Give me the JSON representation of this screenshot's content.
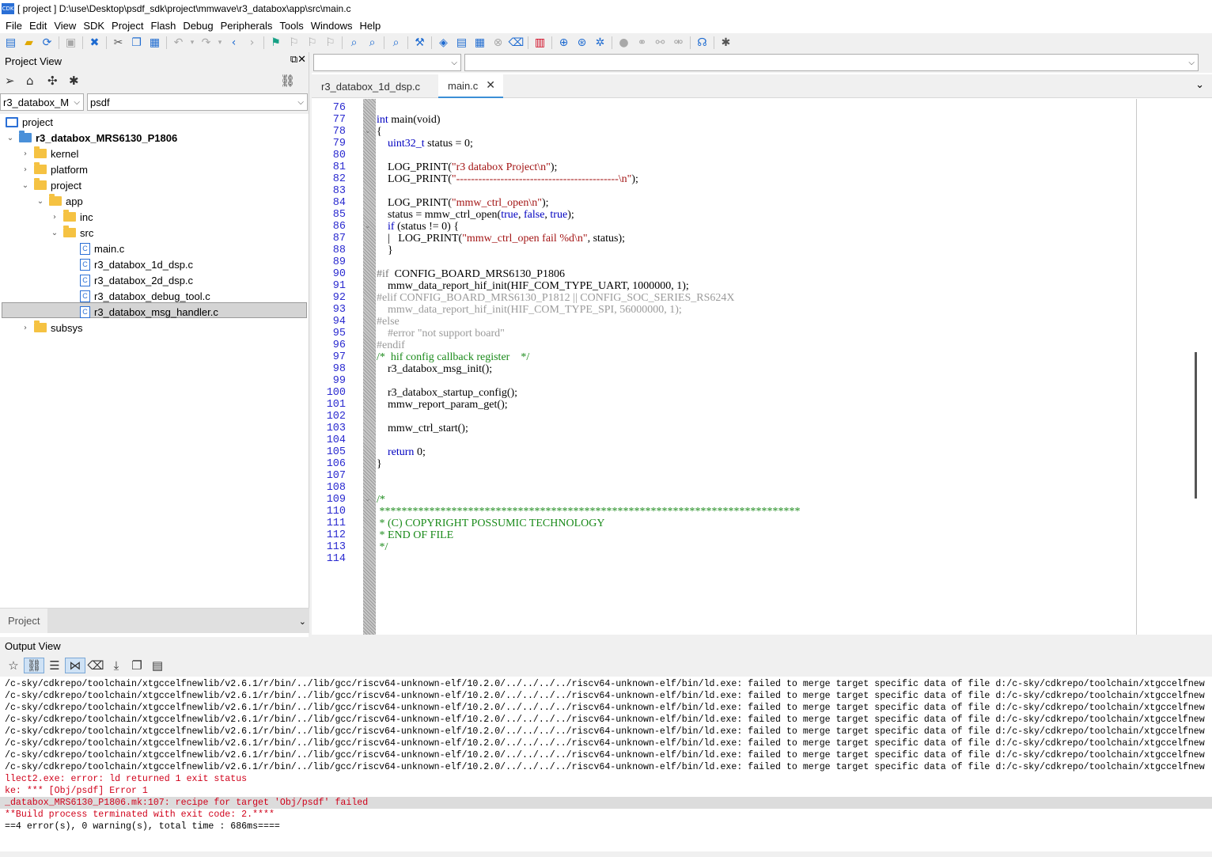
{
  "window": {
    "title": "[ project ] D:\\use\\Desktop\\psdf_sdk\\project\\mmwave\\r3_databox\\app\\src\\main.c",
    "icon_text": "CDK"
  },
  "menu": [
    "File",
    "Edit",
    "View",
    "SDK",
    "Project",
    "Flash",
    "Debug",
    "Peripherals",
    "Tools",
    "Windows",
    "Help"
  ],
  "project_view": {
    "title": "Project View",
    "combo_project": "r3_databox_M",
    "combo_config": "psdf",
    "tree": [
      {
        "label": "project",
        "depth": 0,
        "type": "root"
      },
      {
        "label": "r3_databox_MRS6130_P1806",
        "depth": 0,
        "type": "blue-folder",
        "bold": true,
        "expanded": true
      },
      {
        "label": "kernel",
        "depth": 1,
        "type": "folder",
        "expanded": false
      },
      {
        "label": "platform",
        "depth": 1,
        "type": "folder",
        "expanded": false
      },
      {
        "label": "project",
        "depth": 1,
        "type": "folder",
        "expanded": true
      },
      {
        "label": "app",
        "depth": 2,
        "type": "folder",
        "expanded": true
      },
      {
        "label": "inc",
        "depth": 3,
        "type": "folder",
        "expanded": false
      },
      {
        "label": "src",
        "depth": 3,
        "type": "folder",
        "expanded": true
      },
      {
        "label": "main.c",
        "depth": 4,
        "type": "cfile",
        "selected": true
      },
      {
        "label": "r3_databox_1d_dsp.c",
        "depth": 4,
        "type": "cfile"
      },
      {
        "label": "r3_databox_2d_dsp.c",
        "depth": 4,
        "type": "cfile"
      },
      {
        "label": "r3_databox_debug_tool.c",
        "depth": 4,
        "type": "cfile"
      },
      {
        "label": "r3_databox_msg_handler.c",
        "depth": 4,
        "type": "cfile"
      },
      {
        "label": "subsys",
        "depth": 1,
        "type": "folder",
        "expanded": false
      }
    ],
    "bottom_tab": "Project"
  },
  "editor": {
    "tabs": [
      {
        "label": "r3_databox_1d_dsp.c",
        "active": false
      },
      {
        "label": "main.c",
        "active": true
      }
    ],
    "lines": [
      {
        "n": "76",
        "t": ""
      },
      {
        "n": "77",
        "t": "int main(void)"
      },
      {
        "n": "78",
        "t": "{"
      },
      {
        "n": "79",
        "t": "    uint32_t status = 0;"
      },
      {
        "n": "80",
        "t": ""
      },
      {
        "n": "81",
        "t": "    LOG_PRINT(\"r3 databox Project\\n\");"
      },
      {
        "n": "82",
        "t": "    LOG_PRINT(\"--------------------------------------------\\n\");"
      },
      {
        "n": "83",
        "t": ""
      },
      {
        "n": "84",
        "t": "    LOG_PRINT(\"mmw_ctrl_open\\n\");"
      },
      {
        "n": "85",
        "t": "    status = mmw_ctrl_open(true, false, true);"
      },
      {
        "n": "86",
        "t": "    if (status != 0) {"
      },
      {
        "n": "87",
        "t": "    |   LOG_PRINT(\"mmw_ctrl_open fail %d\\n\", status);"
      },
      {
        "n": "88",
        "t": "    }"
      },
      {
        "n": "89",
        "t": ""
      },
      {
        "n": "90",
        "t": "#if  CONFIG_BOARD_MRS6130_P1806"
      },
      {
        "n": "91",
        "t": "    mmw_data_report_hif_init(HIF_COM_TYPE_UART, 1000000, 1);"
      },
      {
        "n": "92",
        "t": "#elif CONFIG_BOARD_MRS6130_P1812 || CONFIG_SOC_SERIES_RS624X"
      },
      {
        "n": "93",
        "t": "    mmw_data_report_hif_init(HIF_COM_TYPE_SPI, 56000000, 1);"
      },
      {
        "n": "94",
        "t": "#else"
      },
      {
        "n": "95",
        "t": "    #error \"not support board\""
      },
      {
        "n": "96",
        "t": "#endif"
      },
      {
        "n": "97",
        "t": "/*  hif config callback register    */"
      },
      {
        "n": "98",
        "t": "    r3_databox_msg_init();"
      },
      {
        "n": "99",
        "t": ""
      },
      {
        "n": "100",
        "t": "    r3_databox_startup_config();"
      },
      {
        "n": "101",
        "t": "    mmw_report_param_get();"
      },
      {
        "n": "102",
        "t": ""
      },
      {
        "n": "103",
        "t": "    mmw_ctrl_start();"
      },
      {
        "n": "104",
        "t": ""
      },
      {
        "n": "105",
        "t": "    return 0;"
      },
      {
        "n": "106",
        "t": "}"
      },
      {
        "n": "107",
        "t": ""
      },
      {
        "n": "108",
        "t": ""
      },
      {
        "n": "109",
        "t": "/*"
      },
      {
        "n": "110",
        "t": " ****************************************************************************"
      },
      {
        "n": "111",
        "t": " * (C) COPYRIGHT POSSUMIC TECHNOLOGY"
      },
      {
        "n": "112",
        "t": " * END OF FILE"
      },
      {
        "n": "113",
        "t": " */"
      },
      {
        "n": "114",
        "t": ""
      }
    ]
  },
  "output_view": {
    "title": "Output View",
    "lines": [
      {
        "t": "/c-sky/cdkrepo/toolchain/xtgccelfnewlib/v2.6.1/r/bin/../lib/gcc/riscv64-unknown-elf/10.2.0/../../../../riscv64-unknown-elf/bin/ld.exe: failed to merge target specific data of file d:/c-sky/cdkrepo/toolchain/xtgccelfnew",
        "k": "n"
      },
      {
        "t": "/c-sky/cdkrepo/toolchain/xtgccelfnewlib/v2.6.1/r/bin/../lib/gcc/riscv64-unknown-elf/10.2.0/../../../../riscv64-unknown-elf/bin/ld.exe: failed to merge target specific data of file d:/c-sky/cdkrepo/toolchain/xtgccelfnew",
        "k": "n"
      },
      {
        "t": "/c-sky/cdkrepo/toolchain/xtgccelfnewlib/v2.6.1/r/bin/../lib/gcc/riscv64-unknown-elf/10.2.0/../../../../riscv64-unknown-elf/bin/ld.exe: failed to merge target specific data of file d:/c-sky/cdkrepo/toolchain/xtgccelfnew",
        "k": "n"
      },
      {
        "t": "/c-sky/cdkrepo/toolchain/xtgccelfnewlib/v2.6.1/r/bin/../lib/gcc/riscv64-unknown-elf/10.2.0/../../../../riscv64-unknown-elf/bin/ld.exe: failed to merge target specific data of file d:/c-sky/cdkrepo/toolchain/xtgccelfnew",
        "k": "n"
      },
      {
        "t": "/c-sky/cdkrepo/toolchain/xtgccelfnewlib/v2.6.1/r/bin/../lib/gcc/riscv64-unknown-elf/10.2.0/../../../../riscv64-unknown-elf/bin/ld.exe: failed to merge target specific data of file d:/c-sky/cdkrepo/toolchain/xtgccelfnew",
        "k": "n"
      },
      {
        "t": "/c-sky/cdkrepo/toolchain/xtgccelfnewlib/v2.6.1/r/bin/../lib/gcc/riscv64-unknown-elf/10.2.0/../../../../riscv64-unknown-elf/bin/ld.exe: failed to merge target specific data of file d:/c-sky/cdkrepo/toolchain/xtgccelfnew",
        "k": "n"
      },
      {
        "t": "/c-sky/cdkrepo/toolchain/xtgccelfnewlib/v2.6.1/r/bin/../lib/gcc/riscv64-unknown-elf/10.2.0/../../../../riscv64-unknown-elf/bin/ld.exe: failed to merge target specific data of file d:/c-sky/cdkrepo/toolchain/xtgccelfnew",
        "k": "n"
      },
      {
        "t": "/c-sky/cdkrepo/toolchain/xtgccelfnewlib/v2.6.1/r/bin/../lib/gcc/riscv64-unknown-elf/10.2.0/../../../../riscv64-unknown-elf/bin/ld.exe: failed to merge target specific data of file d:/c-sky/cdkrepo/toolchain/xtgccelfnew",
        "k": "n"
      },
      {
        "t": "llect2.exe: error: ld returned 1 exit status",
        "k": "e"
      },
      {
        "t": "ke: *** [Obj/psdf] Error 1",
        "k": "e"
      },
      {
        "t": "_databox_MRS6130_P1806.mk:107: recipe for target 'Obj/psdf' failed",
        "k": "h"
      },
      {
        "t": "**Build process terminated with exit code: 2.****",
        "k": "e"
      },
      {
        "t": "==4 error(s), 0 warning(s), total time : 686ms====",
        "k": "n"
      }
    ]
  },
  "colors": {
    "keyword": "#0000c0",
    "string": "#a31515",
    "comment": "#1a8a1a",
    "preproc_disabled": "#9a9a9a",
    "line_number": "#2b2bd0",
    "error_text": "#d0021b",
    "tab_accent": "#3c8fd6"
  }
}
